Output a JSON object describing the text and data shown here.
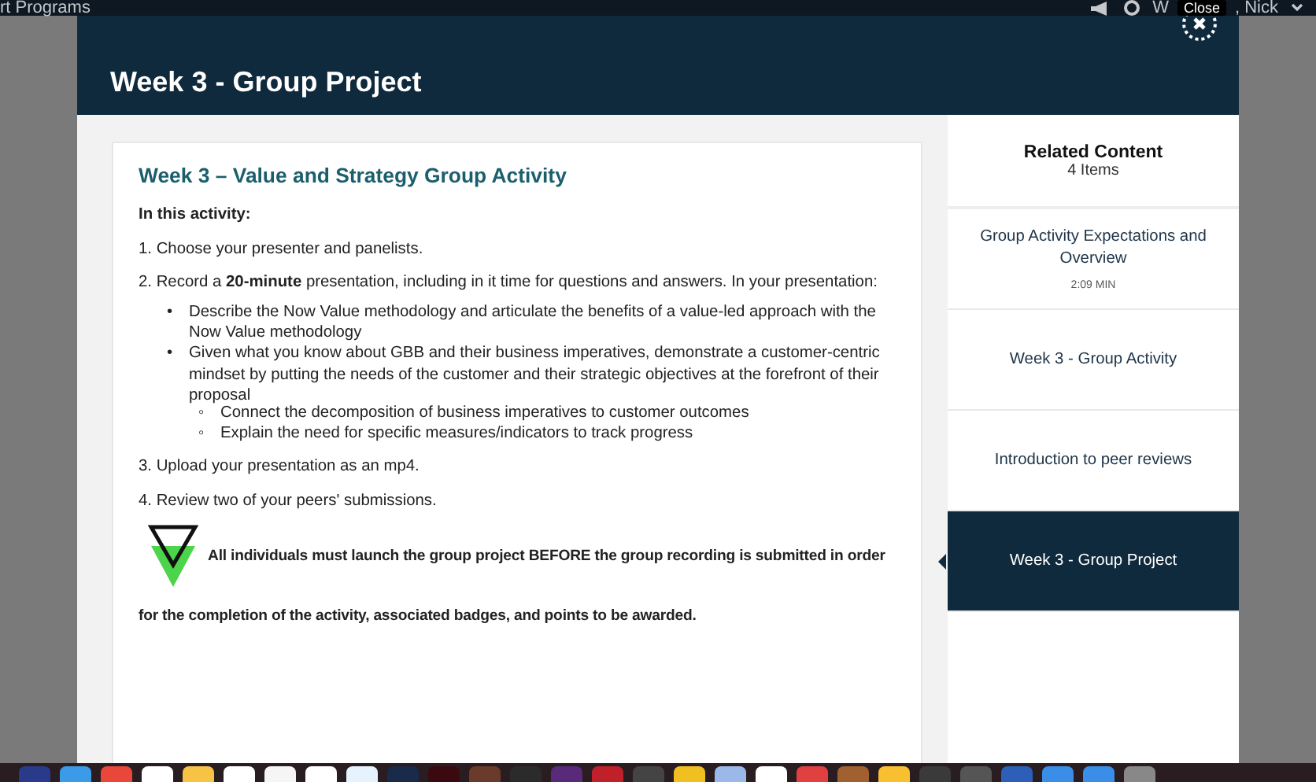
{
  "top_bar": {
    "section": "rt Programs",
    "user_start": "W",
    "user_end": ", Nick"
  },
  "modal": {
    "title": "Week 3 - Group Project",
    "close_tooltip": "Close"
  },
  "activity": {
    "heading": "Week 3 – Value and Strategy Group Activity",
    "intro": "In this activity:",
    "steps": [
      {
        "text": "1. Choose your presenter and panelists."
      },
      {
        "text": "2. Record a **20-minute** presentation, including in it time for questions and answers. In your presentation:",
        "bullets": [
          {
            "marker": "•",
            "text": "Describe the Now Value methodology and articulate the benefits of a value-led approach with the Now Value methodology"
          },
          {
            "marker": "•",
            "text": "Given what you know about GBB and their business imperatives, demonstrate a customer-centric mindset by putting the needs of the customer and their strategic objectives at the forefront of their proposal",
            "children": [
              {
                "marker": "◦",
                "text": "Connect the decomposition of business imperatives to customer outcomes"
              },
              {
                "marker": "◦",
                "text": "Explain the need for specific measures/indicators to track progress"
              }
            ]
          }
        ]
      },
      {
        "text": "3. Upload your presentation as an mp4."
      },
      {
        "text": "4. Review two of your peers' submissions."
      }
    ],
    "notice_lines": [
      "All individuals must launch the group project BEFORE the group recording is submitted in order",
      "for the completion of the activity, associated badges, and points to be awarded."
    ]
  },
  "related": {
    "title": "Related Content",
    "count": "4 Items",
    "items": [
      {
        "title": "Group Activity Expectations and Overview",
        "duration": "2:09 MIN",
        "selected": false
      },
      {
        "title": "Week 3 - Group Activity",
        "selected": false
      },
      {
        "title": "Introduction to peer reviews",
        "selected": false
      },
      {
        "title": "Week 3 - Group Project",
        "selected": true
      }
    ]
  }
}
